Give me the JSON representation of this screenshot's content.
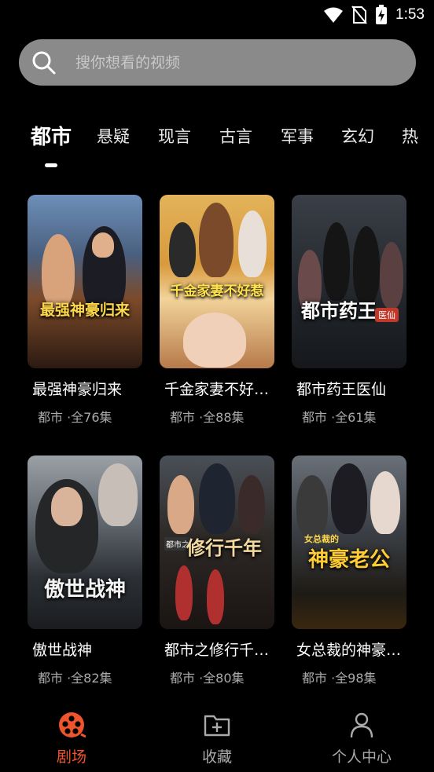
{
  "status_bar": {
    "time": "1:53",
    "icons": [
      "wifi-icon",
      "no-sim-icon",
      "battery-charging-icon"
    ]
  },
  "search": {
    "placeholder": "搜你想看的视频",
    "value": ""
  },
  "tabs": [
    {
      "label": "都市",
      "active": true
    },
    {
      "label": "悬疑",
      "active": false
    },
    {
      "label": "现言",
      "active": false
    },
    {
      "label": "古言",
      "active": false
    },
    {
      "label": "军事",
      "active": false
    },
    {
      "label": "玄幻",
      "active": false
    },
    {
      "label": "热",
      "active": false
    }
  ],
  "dramas": [
    {
      "title": "最强神豪归来",
      "poster_text": "最强神豪归来",
      "meta": "都市 ·全76集"
    },
    {
      "title": "千金家妻不好…",
      "poster_text": "千金家妻不好惹",
      "meta": "都市 ·全88集"
    },
    {
      "title": "都市药王医仙",
      "poster_text": "都市药王",
      "poster_badge": "医仙",
      "meta": "都市 ·全61集"
    },
    {
      "title": "傲世战神",
      "poster_text": "傲世战神",
      "meta": "都市 ·全82集"
    },
    {
      "title": "都市之修行千…",
      "poster_text": "修行千年",
      "poster_badge": "都市之",
      "meta": "都市 ·全80集"
    },
    {
      "title": "女总裁的神豪…",
      "poster_text": "神豪老公",
      "poster_badge": "女总裁的",
      "meta": "都市 ·全98集"
    }
  ],
  "bottom_nav": [
    {
      "label": "剧场",
      "icon": "film-reel-icon",
      "active": true
    },
    {
      "label": "收藏",
      "icon": "folder-add-icon",
      "active": false
    },
    {
      "label": "个人中心",
      "icon": "user-icon",
      "active": false
    }
  ],
  "colors": {
    "accent": "#f0542c",
    "background": "#000000",
    "search_bg": "#8a8a8a"
  }
}
